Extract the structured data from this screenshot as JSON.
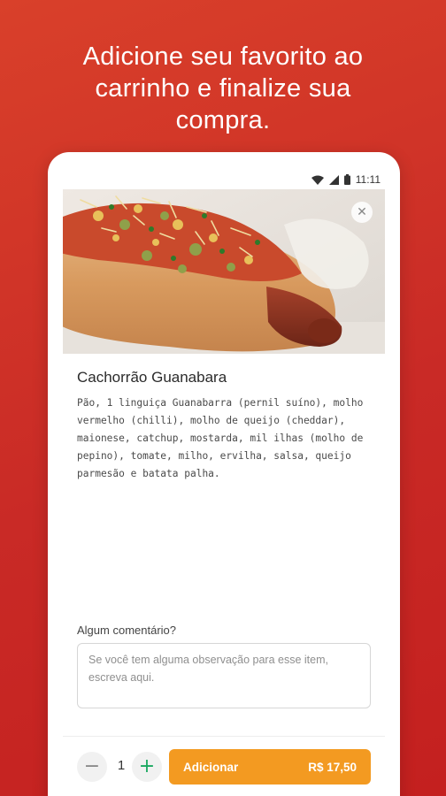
{
  "headline": "Adicione seu  favorito ao\ncarrinho e finalize sua\ncompra.",
  "status_bar": {
    "time": "11:11",
    "icons": [
      "wifi-icon",
      "signal-icon",
      "battery-icon"
    ]
  },
  "product": {
    "image_icon": "hot-dog-photo",
    "close_icon": "close-icon",
    "name": "Cachorrão Guanabara",
    "description": "Pão, 1 linguiça Guanabarra (pernil suíno), molho vermelho (chilli), molho de queijo (cheddar), maionese, catchup, mostarda, mil ilhas (molho de pepino), tomate, milho, ervilha, salsa, queijo parmesão e batata palha."
  },
  "comment": {
    "label": "Algum comentário?",
    "placeholder": "Se você tem alguma observação para esse item, escreva aqui."
  },
  "cart": {
    "minus_label": "−",
    "plus_label": "+",
    "quantity": "1",
    "add_label": "Adicionar",
    "price": "R$ 17,50"
  },
  "colors": {
    "background_start": "#d9402a",
    "background_end": "#c4201f",
    "accent_button": "#f39a21",
    "plus_icon": "#1aa860"
  }
}
